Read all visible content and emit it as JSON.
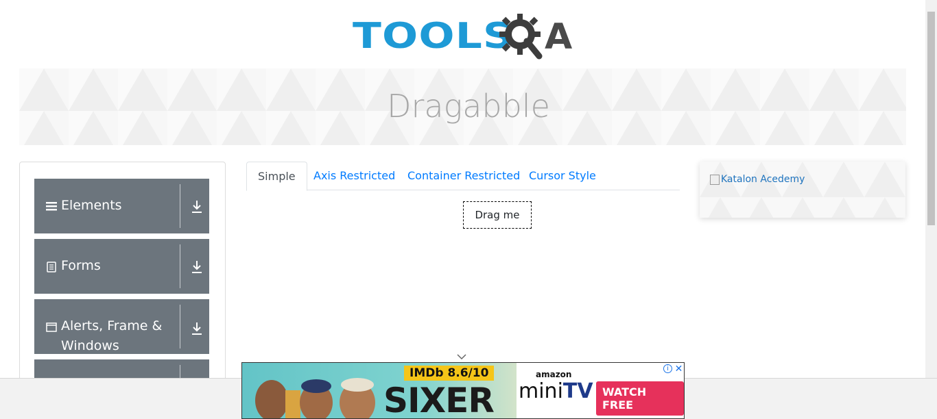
{
  "header": {
    "logo_text_left": "TOOLS",
    "logo_text_right": "A",
    "logo_icon": "gear-magnifier-icon"
  },
  "banner": {
    "title": "Dragabble"
  },
  "sidebar": {
    "groups": [
      {
        "label": "Elements",
        "icon": "hamburger-icon"
      },
      {
        "label": "Forms",
        "icon": "document-icon"
      },
      {
        "label": "Alerts, Frame &",
        "label2": "Windows",
        "icon": "window-icon"
      },
      {
        "label": "",
        "icon": ""
      }
    ]
  },
  "tabs": [
    {
      "label": "Simple",
      "active": true
    },
    {
      "label": "Axis Restricted",
      "active": false
    },
    {
      "label": "Container Restricted",
      "active": false
    },
    {
      "label": "Cursor Style",
      "active": false
    }
  ],
  "drag_box": {
    "label": "Drag me"
  },
  "ad_card": {
    "alt_text": "Katalon Acedemy"
  },
  "bottom_ad": {
    "rating": "IMDb 8.6/10",
    "show": "SIXER",
    "brand_small": "amazon",
    "brand_big_left": "mini",
    "brand_big_right": "TV",
    "cta": "WATCH FREE",
    "info": "i",
    "close": "✕"
  },
  "colors": {
    "logo_blue": "#1e9ad6",
    "logo_dark": "#4a4a4a",
    "sidebar_group_bg": "#6c757d",
    "link_blue": "#007bff",
    "cta_pink": "#e6315b",
    "imdb_yellow": "#f5c518"
  }
}
